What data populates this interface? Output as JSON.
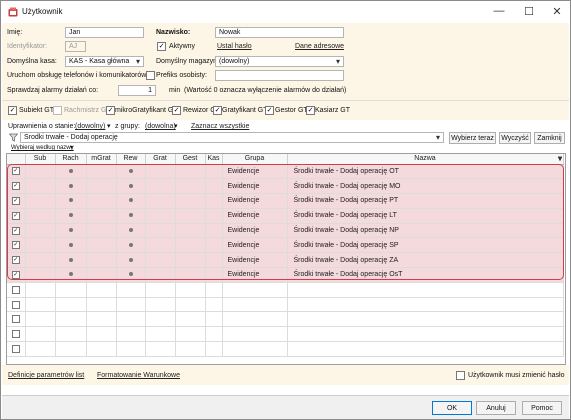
{
  "window": {
    "title": "Użytkownik",
    "controls": {
      "minimize": "—",
      "maximize": "☐",
      "close": "✕"
    }
  },
  "form": {
    "imie_label": "Imię:",
    "imie_value": "Jan",
    "nazwisko_label": "Nazwisko:",
    "nazwisko_value": "Nowak",
    "identyfikator_label": "Identyfikator:",
    "identyfikator_value": "AJ",
    "aktywny_label": "Aktywny",
    "aktywny_checked": true,
    "ustal_haslo": "Ustal hasło",
    "dane_adresowe": "Dane adresowe",
    "kasa_label": "Domyślna kasa:",
    "kasa_value": "KAS - Kasa główna",
    "magazyn_label": "Domyślny magazyn:",
    "magazyn_value": "(dowolny)",
    "uruchom_label": "Uruchom obsługę telefonów i komunikatorów",
    "prefiks_label": "Prefiks osobisty:",
    "prefiks_value": "",
    "sprawdzaj_label": "Sprawdzaj alarmy działań co:",
    "sprawdzaj_value": "1",
    "min_label": "min",
    "alarm_note": "(Wartość 0 oznacza wyłączenie alarmów do działań)"
  },
  "filters": [
    {
      "label": "Subiekt GT",
      "checked": true,
      "disabled": false
    },
    {
      "label": "Rachmistrz GT",
      "checked": false,
      "disabled": true
    },
    {
      "label": "mikroGratyfikant GT",
      "checked": true,
      "disabled": false
    },
    {
      "label": "Rewizor GT",
      "checked": true,
      "disabled": false
    },
    {
      "label": "Gratyfikant GT",
      "checked": true,
      "disabled": false
    },
    {
      "label": "Gestor GT",
      "checked": true,
      "disabled": false
    },
    {
      "label": "Kasiarz GT",
      "checked": true,
      "disabled": false
    }
  ],
  "toolbar": {
    "uprawnienia_label": "Uprawnienia o stanie:",
    "uprawnienia_value": "(dowolny)",
    "grupy_label": "z grupy:",
    "grupy_value": "(dowolna)",
    "zaznacz": "Zaznacz wszystkie",
    "search_value": "Środki trwałe - Dodaj operację",
    "wybierz_teraz": "Wybierz teraz",
    "wyczysc": "Wyczyść",
    "zamknij": "Zamknij",
    "wybieraj": "Wybieraj według nazwy"
  },
  "grid": {
    "columns": [
      "",
      "Sub",
      "Rach",
      "mGrat",
      "Rew",
      "Grat",
      "Gest",
      "Kas",
      "Grupa",
      "Nazwa"
    ],
    "rows": [
      {
        "checked": true,
        "rach": true,
        "rew": true,
        "grupa": "Ewidencje",
        "nazwa": "Środki trwałe - Dodaj operację OT"
      },
      {
        "checked": true,
        "rach": true,
        "rew": true,
        "grupa": "Ewidencje",
        "nazwa": "Środki trwałe - Dodaj operację MO"
      },
      {
        "checked": true,
        "rach": true,
        "rew": true,
        "grupa": "Ewidencje",
        "nazwa": "Środki trwałe - Dodaj operację PT"
      },
      {
        "checked": true,
        "rach": true,
        "rew": true,
        "grupa": "Ewidencje",
        "nazwa": "Środki trwałe - Dodaj operację LT"
      },
      {
        "checked": true,
        "rach": true,
        "rew": true,
        "grupa": "Ewidencje",
        "nazwa": "Środki trwałe - Dodaj operację NP"
      },
      {
        "checked": true,
        "rach": true,
        "rew": true,
        "grupa": "Ewidencje",
        "nazwa": "Środki trwałe - Dodaj operację SP"
      },
      {
        "checked": true,
        "rach": true,
        "rew": true,
        "grupa": "Ewidencje",
        "nazwa": "Środki trwałe - Dodaj operację ZA"
      },
      {
        "checked": true,
        "rach": true,
        "rew": true,
        "grupa": "Ewidencje",
        "nazwa": "Środki trwałe - Dodaj operację OsT"
      },
      {
        "checked": false
      },
      {
        "checked": false
      },
      {
        "checked": false
      },
      {
        "checked": false
      },
      {
        "checked": false
      }
    ]
  },
  "footer": {
    "definicje": "Definicje parametrów list",
    "formatowanie": "Formatowanie Warunkowe",
    "zmienic_haslo": "Użytkownik musi zmienić hasło"
  },
  "buttons": {
    "ok": "OK",
    "anuluj": "Anuluj",
    "pomoc": "Pomoc"
  },
  "colors": {
    "form_bg": "#fdf6e6",
    "selected_row": "#f4dadd",
    "highlight_border": "#d43c4a"
  }
}
